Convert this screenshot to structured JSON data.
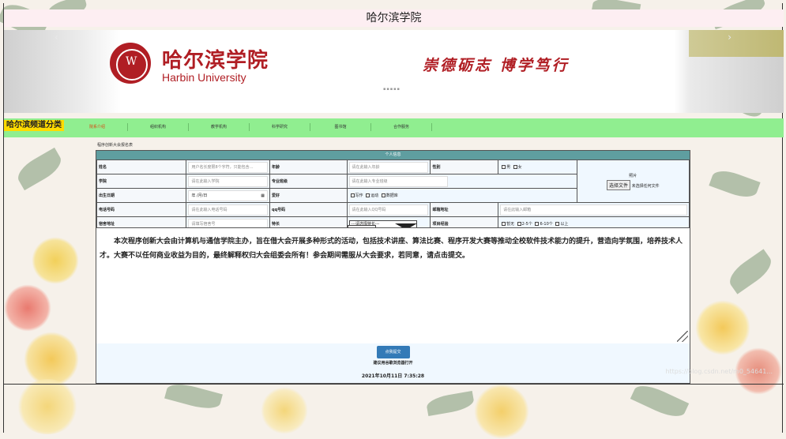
{
  "header": {
    "title": "哈尔滨学院"
  },
  "banner": {
    "logo_cn": "哈尔滨学院",
    "logo_en": "Harbin  University",
    "motto": "崇德砺志  博学笃行",
    "dots": "▪▪▪▪▪",
    "prev_icon": "‹",
    "next_icon": "›"
  },
  "nav": {
    "brand": "哈尔滨频道分类",
    "items": [
      "院系介绍",
      "组织机构",
      "教学机构",
      "科学研究",
      "图书馆",
      "合作服务"
    ]
  },
  "breadcrumb": "程序创新大会报名表",
  "form": {
    "heading": "个人信息",
    "name_label": "姓名",
    "name_placeholder": "用户名长度限8个字符，只能包含…",
    "age_label": "年龄",
    "age_placeholder": "请在此输入年龄",
    "gender_label": "性别",
    "gender_options": [
      "男",
      "女"
    ],
    "photo_label": "照片",
    "file_button": "选择文件",
    "file_status": "未选择任何文件",
    "college_label": "学院",
    "college_placeholder": "请在此输入学院",
    "major_label": "专业班级",
    "major_placeholder": "请在此输入专业班级",
    "birth_label": "出生日期",
    "birth_value": "年 /月/日",
    "hobby_label": "爱好",
    "hobby_options": [
      "写作",
      "运动",
      "数据库"
    ],
    "phone_label": "电话号码",
    "phone_placeholder": "请在此输入电话号码",
    "qq_label": "qq号码",
    "qq_placeholder": "请在此输入QQ号码",
    "email_label": "邮箱地址",
    "email_placeholder": "请在此输入邮箱",
    "address_label": "宿舍地址",
    "address_placeholder": "请填写宿舍号",
    "skill_label": "特长",
    "skill_select": "---请选择特长---",
    "project_label": "项目经验",
    "project_options": [
      "暂无",
      "2-5个",
      "6-10个",
      "以上"
    ],
    "description": "本次程序创新大会由计算机与通信学院主办，旨在借大会开展多种形式的活动，包括技术讲座、算法比赛、程序开发大赛等推动全校软件技术能力的提升，营造向学氛围，培养技术人才。大赛不以任何商业收益为目的，最终解释权归大会组委会所有！参会期间需服从大会要求，若同意，请点击提交。",
    "submit_label": "点我提交",
    "notice": "建议用谷歌浏览器打开",
    "clock": "2021年10月11日  7:35:28"
  },
  "watermark": "https://blog.csdn.net/m0_54641..."
}
